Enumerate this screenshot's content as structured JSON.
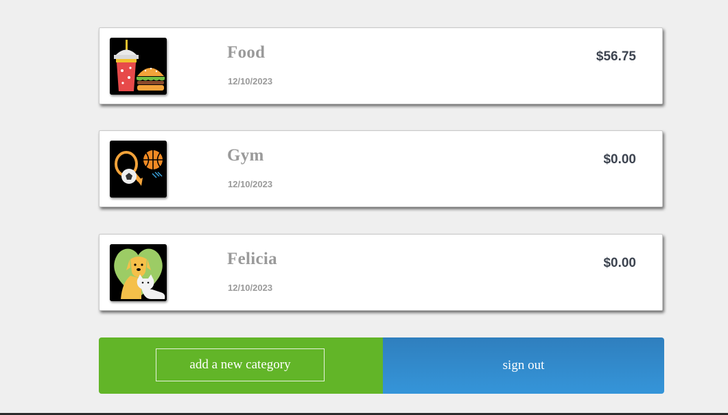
{
  "categories": [
    {
      "name": "Food",
      "date": "12/10/2023",
      "amount": "$56.75",
      "icon": "food-icon"
    },
    {
      "name": "Gym",
      "date": "12/10/2023",
      "amount": "$0.00",
      "icon": "sports-icon"
    },
    {
      "name": "Felicia",
      "date": "12/10/2023",
      "amount": "$0.00",
      "icon": "pets-icon"
    }
  ],
  "actions": {
    "add_label": "add a new category",
    "signout_label": "sign out"
  },
  "colors": {
    "background": "#efefef",
    "title_gray": "#9a9a9a",
    "amount": "#3d4450",
    "add_green": "#62b528",
    "signout_blue": "#3595d9"
  }
}
